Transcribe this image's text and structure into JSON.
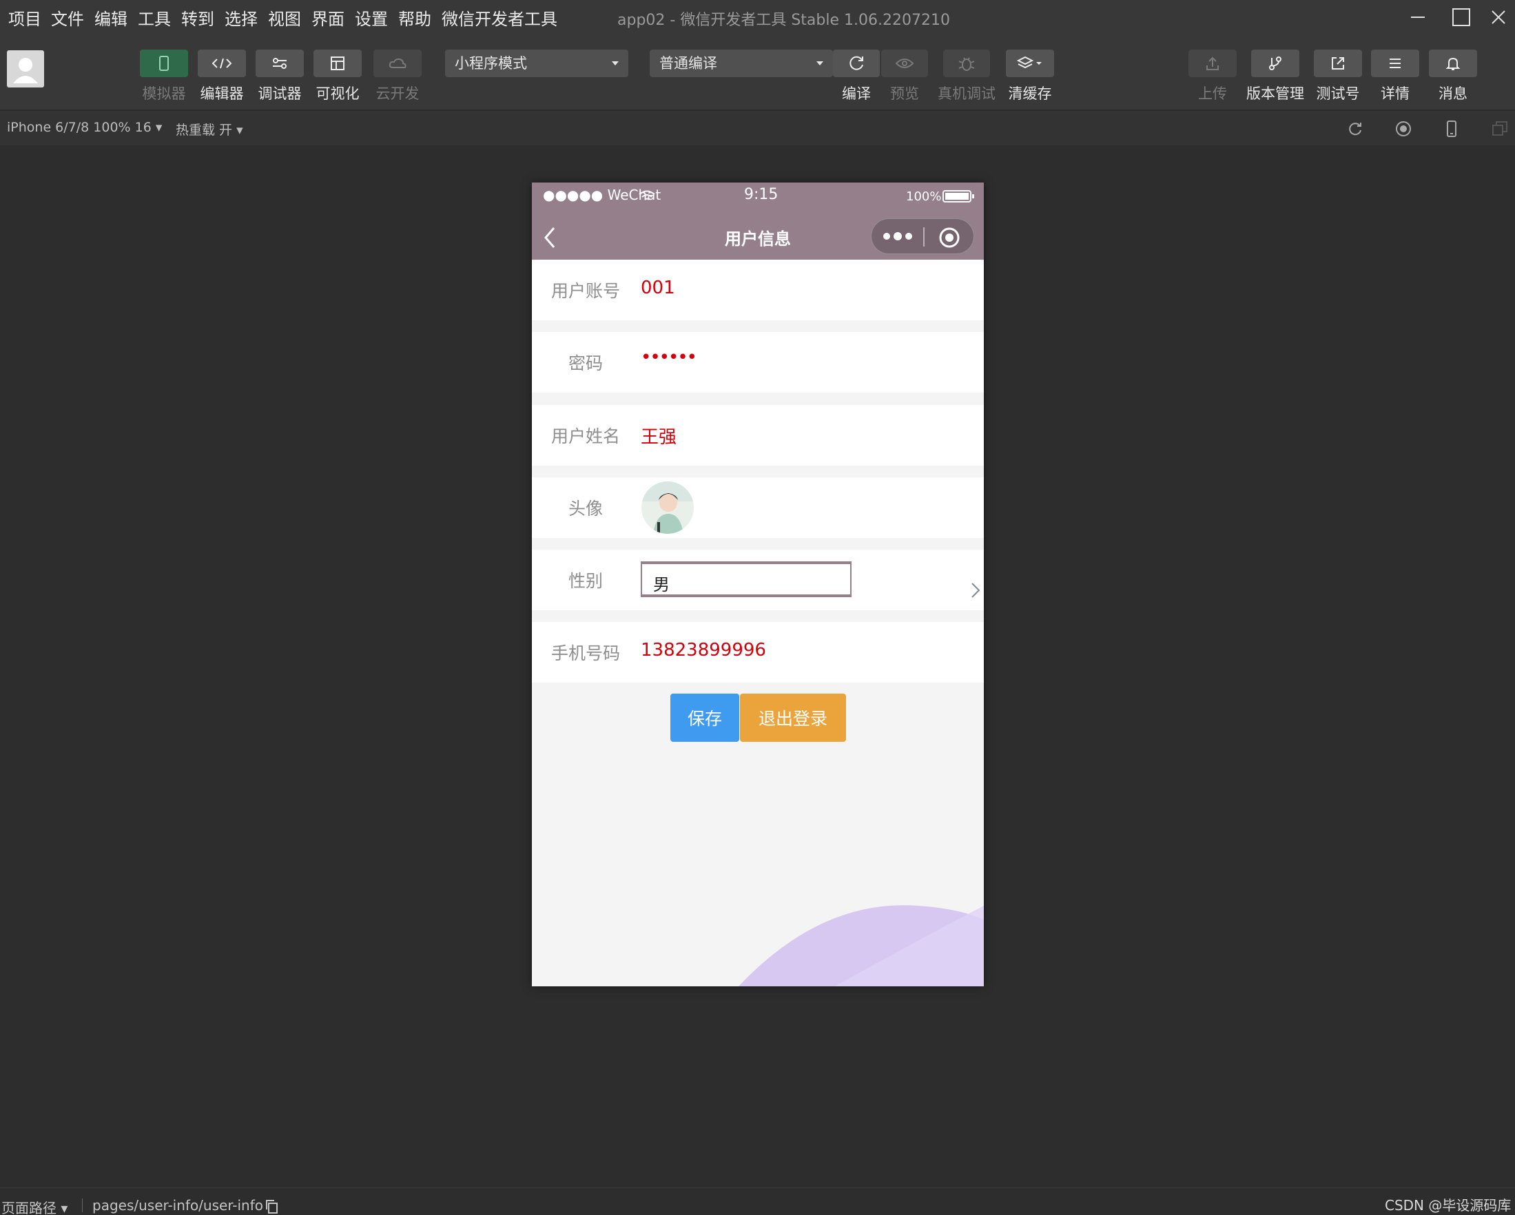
{
  "menu": [
    "项目",
    "文件",
    "编辑",
    "工具",
    "转到",
    "选择",
    "视图",
    "界面",
    "设置",
    "帮助",
    "微信开发者工具"
  ],
  "window_title": "app02 - 微信开发者工具 Stable 1.06.2207210",
  "toolbar": {
    "left_buttons": [
      {
        "label": "模拟器",
        "icon": "phone-icon",
        "state": "active"
      },
      {
        "label": "编辑器",
        "icon": "code-icon",
        "state": "normal"
      },
      {
        "label": "调试器",
        "icon": "debug-icon",
        "state": "normal"
      },
      {
        "label": "可视化",
        "icon": "layout-icon",
        "state": "normal"
      },
      {
        "label": "云开发",
        "icon": "cloud-icon",
        "state": "disabled"
      }
    ],
    "mode_select": "小程序模式",
    "compile_select": "普通编译",
    "mid_buttons": [
      {
        "label": "编译",
        "icon": "refresh-icon",
        "state": "normal"
      },
      {
        "label": "预览",
        "icon": "eye-icon",
        "state": "disabled"
      },
      {
        "label": "真机调试",
        "icon": "bug-icon",
        "state": "disabled"
      },
      {
        "label": "清缓存",
        "icon": "layers-icon",
        "state": "normal"
      }
    ],
    "right_buttons": [
      {
        "label": "上传",
        "icon": "upload-icon",
        "state": "disabled"
      },
      {
        "label": "版本管理",
        "icon": "branch-icon",
        "state": "normal"
      },
      {
        "label": "测试号",
        "icon": "external-link-icon",
        "state": "normal"
      },
      {
        "label": "详情",
        "icon": "menu-icon",
        "state": "normal"
      },
      {
        "label": "消息",
        "icon": "bell-icon",
        "state": "normal"
      }
    ]
  },
  "subbar": {
    "device": "iPhone 6/7/8 100% 16",
    "hot_reload": "热重载 开"
  },
  "phone": {
    "status": {
      "signal": "●●●●● WeChat",
      "time": "9:15",
      "battery": "100%"
    },
    "nav_title": "用户信息",
    "rows": [
      {
        "label": "用户账号",
        "value": "001"
      },
      {
        "label": "密码",
        "value": "••••••"
      },
      {
        "label": "用户姓名",
        "value": "王强"
      },
      {
        "label": "头像",
        "value": ""
      },
      {
        "label": "性别",
        "value": "男"
      },
      {
        "label": "手机号码",
        "value": "13823899996"
      }
    ],
    "save_label": "保存",
    "logout_label": "退出登录",
    "colors": {
      "nav": "#957f8b",
      "value": "#d4000b",
      "save": "#3e9bf0",
      "logout": "#eaa43b"
    }
  },
  "footer": {
    "path_label": "页面路径",
    "path": "pages/user-info/user-info",
    "watermark": "CSDN @毕设源码库"
  }
}
